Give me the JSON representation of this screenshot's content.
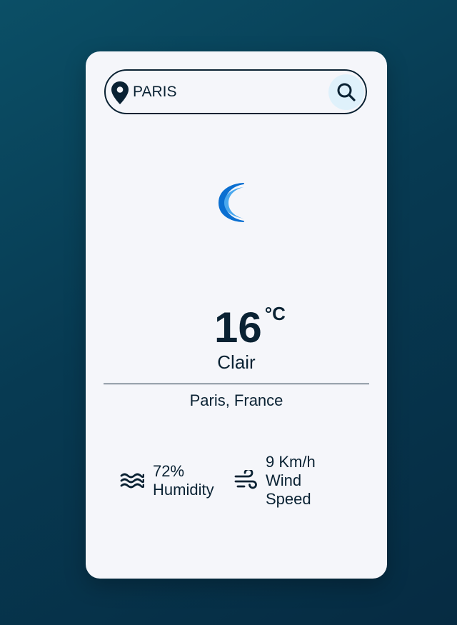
{
  "search": {
    "value": "PARIS",
    "placeholder": ""
  },
  "weather": {
    "icon": "crescent-moon-icon",
    "temperature": "16",
    "unit": "°C",
    "condition": "Clair",
    "location": "Paris, France"
  },
  "stats": {
    "humidity": {
      "icon": "waves-icon",
      "value": "72%",
      "label": "Humidity"
    },
    "wind": {
      "icon": "wind-icon",
      "value": "9 Km/h",
      "label_line1": "Wind",
      "label_line2": "Speed"
    }
  },
  "colors": {
    "accent_blue": "#0a6fd1",
    "text_dark": "#0a2233",
    "card_bg": "#f5f6fa",
    "search_button_bg": "#dff1fb"
  }
}
